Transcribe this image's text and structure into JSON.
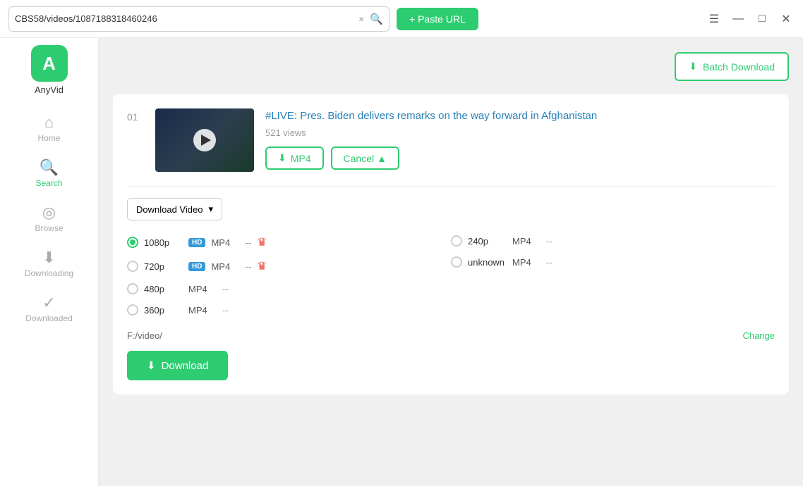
{
  "titlebar": {
    "url": "CBS58/videos/1087188318460246",
    "clear_label": "×",
    "paste_label": "+ Paste URL",
    "window_controls": {
      "menu": "☰",
      "minimize": "—",
      "maximize": "□",
      "close": "✕"
    }
  },
  "sidebar": {
    "app_name": "AnyVid",
    "logo_letter": "A",
    "items": [
      {
        "id": "home",
        "label": "Home",
        "icon": "⌂"
      },
      {
        "id": "search",
        "label": "Search",
        "icon": "🔍"
      },
      {
        "id": "browse",
        "label": "Browse",
        "icon": "◎"
      },
      {
        "id": "downloading",
        "label": "Downloading",
        "icon": "⬇"
      },
      {
        "id": "downloaded",
        "label": "Downloaded",
        "icon": "✓"
      }
    ]
  },
  "batch_download_label": "Batch Download",
  "video": {
    "index": "01",
    "title": "#LIVE: Pres. Biden delivers remarks on the way forward in Afghanistan",
    "views": "521 views",
    "mp4_btn": "MP4",
    "cancel_btn": "Cancel",
    "dropdown_label": "Download Video",
    "resolutions": [
      {
        "id": "1080p",
        "label": "1080p",
        "hd": true,
        "format": "MP4",
        "dash": "--",
        "premium": true,
        "selected": true
      },
      {
        "id": "720p",
        "label": "720p",
        "hd": true,
        "format": "MP4",
        "dash": "--",
        "premium": true,
        "selected": false
      },
      {
        "id": "480p",
        "label": "480p",
        "hd": false,
        "format": "MP4",
        "dash": "--",
        "premium": false,
        "selected": false
      },
      {
        "id": "360p",
        "label": "360p",
        "hd": false,
        "format": "MP4",
        "dash": "--",
        "premium": false,
        "selected": false
      }
    ],
    "resolutions_right": [
      {
        "id": "240p",
        "label": "240p",
        "format": "MP4",
        "dash": "--",
        "premium": false,
        "selected": false
      },
      {
        "id": "unknown",
        "label": "unknown",
        "format": "MP4",
        "dash": "--",
        "premium": false,
        "selected": false
      }
    ],
    "save_path": "F:/video/",
    "change_label": "Change",
    "download_btn": "Download"
  }
}
